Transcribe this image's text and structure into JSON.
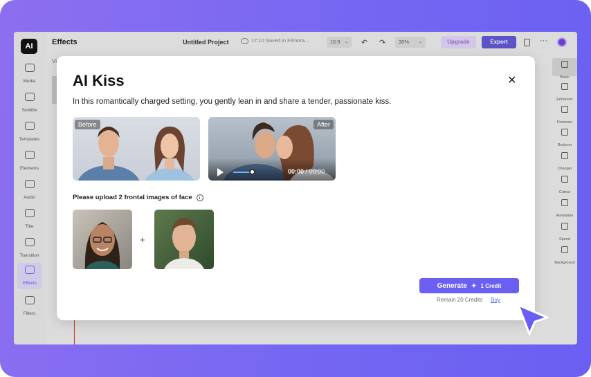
{
  "app": {
    "logo_text": "AI",
    "panel_title": "Effects",
    "panel_subtitle": "Vi",
    "project_title": "Untitled Project",
    "save_status": "17:10 Saved in Filmora...",
    "aspect_ratio": "16:9",
    "zoom": "30%",
    "upgrade_label": "Upgrade",
    "export_label": "Export"
  },
  "nav": [
    {
      "label": "Media"
    },
    {
      "label": "Subtitle"
    },
    {
      "label": "Templates"
    },
    {
      "label": "Elements"
    },
    {
      "label": "Audio"
    },
    {
      "label": "Title"
    },
    {
      "label": "Transition"
    },
    {
      "label": "Effects"
    },
    {
      "label": "Filters"
    }
  ],
  "right_tools": [
    {
      "label": "Basic"
    },
    {
      "label": "Enhancer"
    },
    {
      "label": "Remover"
    },
    {
      "label": "Reducer"
    },
    {
      "label": "Changer"
    },
    {
      "label": "Cutout"
    },
    {
      "label": "Animation"
    },
    {
      "label": "Speed"
    },
    {
      "label": "Background"
    }
  ],
  "modal": {
    "title": "AI Kiss",
    "description": "In this romantically charged setting, you gently lean in and share a tender, passionate kiss.",
    "before_label": "Before",
    "after_label": "After",
    "time_current": "00:00",
    "time_separator": "/",
    "time_total": "00:00",
    "video_progress": 0.0,
    "upload_label": "Please upload 2 frontal images of face",
    "plus_sign": "+",
    "generate_label": "Generate",
    "credit_cost": "1 Credit",
    "remain_text": "Remain 20 Credits",
    "buy_label": "Buy"
  },
  "colors": {
    "accent": "#6a5ff2",
    "export": "#5b53c6",
    "link": "#4f6ef0"
  }
}
